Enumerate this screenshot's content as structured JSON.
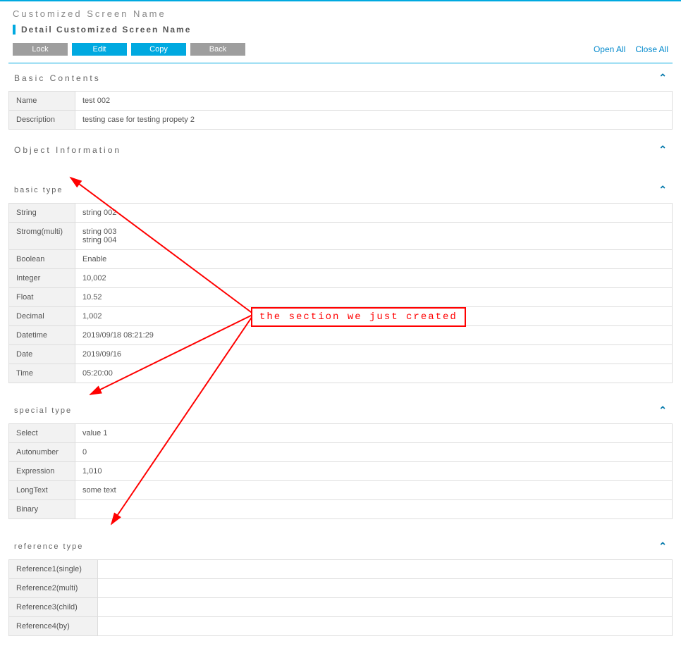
{
  "header": {
    "title": "Customized Screen Name",
    "subtitle": "Detail Customized Screen Name"
  },
  "toolbar": {
    "lock": "Lock",
    "edit": "Edit",
    "copy": "Copy",
    "back": "Back",
    "open_all": "Open All",
    "close_all": "Close All"
  },
  "basic_contents": {
    "title": "Basic Contents",
    "name_lbl": "Name",
    "name_val": "test 002",
    "desc_lbl": "Description",
    "desc_val": "testing case for testing propety 2"
  },
  "object_info": {
    "title": "Object Information"
  },
  "basic_type": {
    "title": "basic type",
    "rows": {
      "string_lbl": "String",
      "string_val": "string 002",
      "strmulti_lbl": "Stromg(multi)",
      "strmulti_val1": "string 003",
      "strmulti_val2": "string 004",
      "boolean_lbl": "Boolean",
      "boolean_val": "Enable",
      "integer_lbl": "Integer",
      "integer_val": "10,002",
      "float_lbl": "Float",
      "float_val": "10.52",
      "decimal_lbl": "Decimal",
      "decimal_val": "1,002",
      "datetime_lbl": "Datetime",
      "datetime_val": "2019/09/18 08:21:29",
      "date_lbl": "Date",
      "date_val": "2019/09/16",
      "time_lbl": "Time",
      "time_val": "05:20:00"
    }
  },
  "special_type": {
    "title": "special type",
    "rows": {
      "select_lbl": "Select",
      "select_val": "value 1",
      "auton_lbl": "Autonumber",
      "auton_val": "0",
      "expr_lbl": "Expression",
      "expr_val": "1,010",
      "long_lbl": "LongText",
      "long_val": "some text",
      "bin_lbl": "Binary",
      "bin_val": ""
    }
  },
  "reference_type": {
    "title": "reference type",
    "rows": {
      "r1_lbl": "Reference1(single)",
      "r1_val": "",
      "r2_lbl": "Reference2(multi)",
      "r2_val": "",
      "r3_lbl": "Reference3(child)",
      "r3_val": "",
      "r4_lbl": "Reference4(by)",
      "r4_val": ""
    }
  },
  "annotation": {
    "text": "the section we just created"
  }
}
